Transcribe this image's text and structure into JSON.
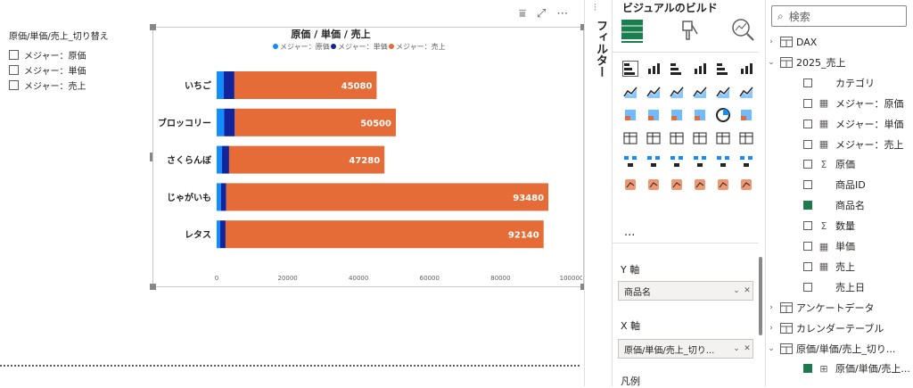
{
  "slicer": {
    "title": "原価/単価/売上_切り替え",
    "options": [
      "メジャー：原価",
      "メジャー：単価",
      "メジャー：売上"
    ]
  },
  "chart_data": {
    "type": "bar",
    "orientation": "horizontal",
    "stacked": true,
    "title": "原価 / 単価 / 売上",
    "categories": [
      "いちご",
      "ブロッコリー",
      "さくらんぼ",
      "じゃがいも",
      "レタス"
    ],
    "series": [
      {
        "name": "メジャー：原価",
        "color": "#118dff",
        "values": [
          2000,
          2100,
          1500,
          1200,
          1000
        ]
      },
      {
        "name": "メジャー：単価",
        "color": "#12239e",
        "values": [
          3000,
          3000,
          2000,
          1500,
          1500
        ]
      },
      {
        "name": "メジャー：売上",
        "color": "#e66c37",
        "values": [
          40080,
          45400,
          43780,
          90780,
          89640
        ]
      }
    ],
    "data_labels": [
      "45080",
      "50500",
      "47280",
      "93480",
      "92140"
    ],
    "xticks": [
      "0",
      "20000",
      "40000",
      "60000",
      "80000",
      "100000"
    ],
    "xlim": [
      0,
      100000
    ],
    "legend_position": "top"
  },
  "filter_strip": {
    "label": "フィルター"
  },
  "build": {
    "title": "ビジュアルのビルド",
    "more": "...",
    "y_axis_label": "Y 軸",
    "y_axis_field": "商品名",
    "x_axis_label": "X 軸",
    "x_axis_field": "原価/単価/売上_切り...",
    "legend_label": "凡例"
  },
  "data_pane": {
    "search_placeholder": "検索",
    "items": [
      {
        "label": "DAX",
        "kind": "table",
        "expanded": false
      },
      {
        "label": "2025_売上",
        "kind": "table",
        "expanded": true
      },
      {
        "label": "カテゴリ",
        "kind": "field",
        "checked": false,
        "icon": ""
      },
      {
        "label": "メジャー：原価",
        "kind": "field",
        "checked": false,
        "icon": "calc"
      },
      {
        "label": "メジャー：単価",
        "kind": "field",
        "checked": false,
        "icon": "calc"
      },
      {
        "label": "メジャー：売上",
        "kind": "field",
        "checked": false,
        "icon": "calc"
      },
      {
        "label": "原価",
        "kind": "field",
        "checked": false,
        "icon": "sigma"
      },
      {
        "label": "商品ID",
        "kind": "field",
        "checked": false,
        "icon": ""
      },
      {
        "label": "商品名",
        "kind": "field",
        "checked": true,
        "icon": ""
      },
      {
        "label": "数量",
        "kind": "field",
        "checked": false,
        "icon": "sigma"
      },
      {
        "label": "単価",
        "kind": "field",
        "checked": false,
        "icon": "calc"
      },
      {
        "label": "売上",
        "kind": "field",
        "checked": false,
        "icon": "calc"
      },
      {
        "label": "売上日",
        "kind": "field",
        "checked": false,
        "icon": ""
      },
      {
        "label": "アンケートデータ",
        "kind": "table",
        "expanded": false
      },
      {
        "label": "カレンダーテーブル",
        "kind": "table",
        "expanded": false
      },
      {
        "label": "原価/単価/売上_切り...",
        "kind": "table",
        "expanded": true
      },
      {
        "label": "原価/単価/売上...",
        "kind": "field",
        "checked": true,
        "icon": "param"
      }
    ]
  }
}
